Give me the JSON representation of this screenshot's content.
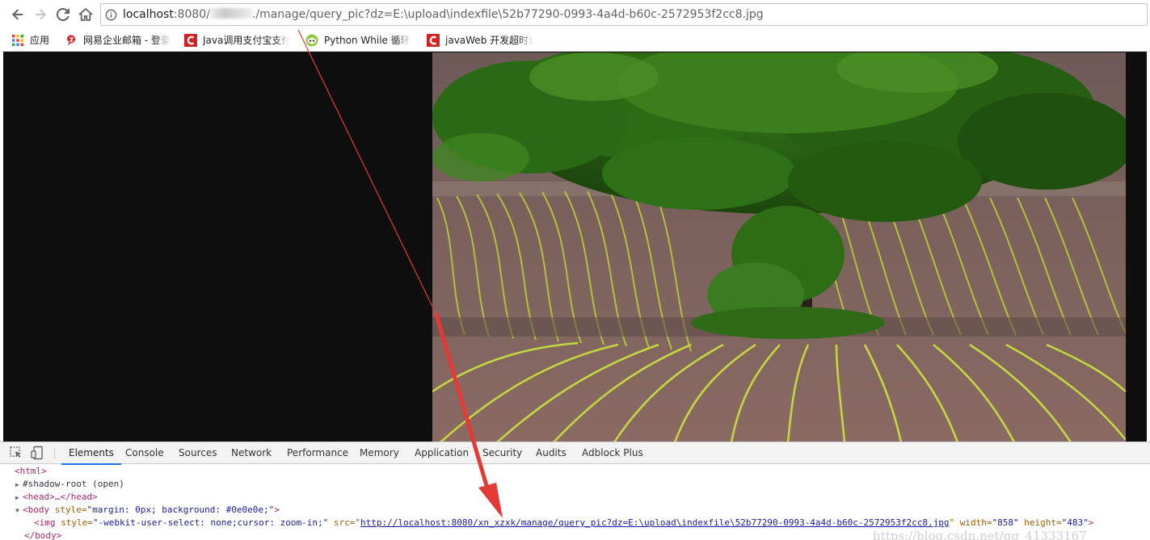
{
  "browser": {
    "nav": {
      "back_icon": "arrow-left-icon",
      "forward_icon": "arrow-right-icon",
      "reload_icon": "reload-icon",
      "home_icon": "home-icon"
    },
    "address_bar": {
      "host": "localhost",
      "port": ":8080/",
      "path": "./manage/query_pic?dz=E:\\upload\\indexfile\\52b77290-0993-4a4d-b60c-2572953f2cc8.jpg",
      "info_icon": "info-icon"
    },
    "bookmarks": [
      {
        "icon": "apps-grid-icon",
        "label": "应用"
      },
      {
        "icon": "netease-icon",
        "label": "网易企业邮箱 - 登录"
      },
      {
        "icon": "csdn-icon",
        "label": "Java调用支付宝支付"
      },
      {
        "icon": "runoob-icon",
        "label": "Python While 循环语"
      },
      {
        "icon": "csdn-icon",
        "label": "javaWeb 开发超时设"
      }
    ]
  },
  "page": {
    "background": "#0e0e0e",
    "image_alt": "tree-in-plowed-field-photo"
  },
  "devtools": {
    "tools": {
      "inspect_icon": "inspect-element-icon",
      "device_icon": "device-toolbar-icon"
    },
    "tabs": [
      {
        "label": "Elements",
        "active": true
      },
      {
        "label": "Console",
        "active": false
      },
      {
        "label": "Sources",
        "active": false
      },
      {
        "label": "Network",
        "active": false
      },
      {
        "label": "Performance",
        "active": false
      },
      {
        "label": "Memory",
        "active": false
      },
      {
        "label": "Application",
        "active": false
      },
      {
        "label": "Security",
        "active": false
      },
      {
        "label": "Audits",
        "active": false
      },
      {
        "label": "Adblock Plus",
        "active": false
      }
    ],
    "accent_color": "#1a73e8",
    "dom": {
      "html_open": "<html>",
      "shadow_root": "#shadow-root (open)",
      "head": "<head>…</head>",
      "body_open_tag": "<body",
      "body_style_attr": " style=",
      "body_style_val": "\"margin: 0px; background: #0e0e0e;\"",
      "body_open_end": ">",
      "img_open": "<img",
      "img_style_attr": " style=",
      "img_style_val": "\"-webkit-user-select: none;cursor: zoom-in;\"",
      "img_src_attr": " src=\"",
      "img_src_val": "http://localhost:8080/xn_xzxk/manage/query_pic?dz=E:\\upload\\indexfile\\52b77290-0993-4a4d-b60c-2572953f2cc8.jpg",
      "img_src_end": "\"",
      "img_width_attr": " width=",
      "img_width_val": "\"858\"",
      "img_height_attr": " height=",
      "img_height_val": "\"483\"",
      "img_close": ">",
      "body_close": "</body>",
      "watermark": "https://blog.csdn.net/qq_41333167"
    }
  }
}
